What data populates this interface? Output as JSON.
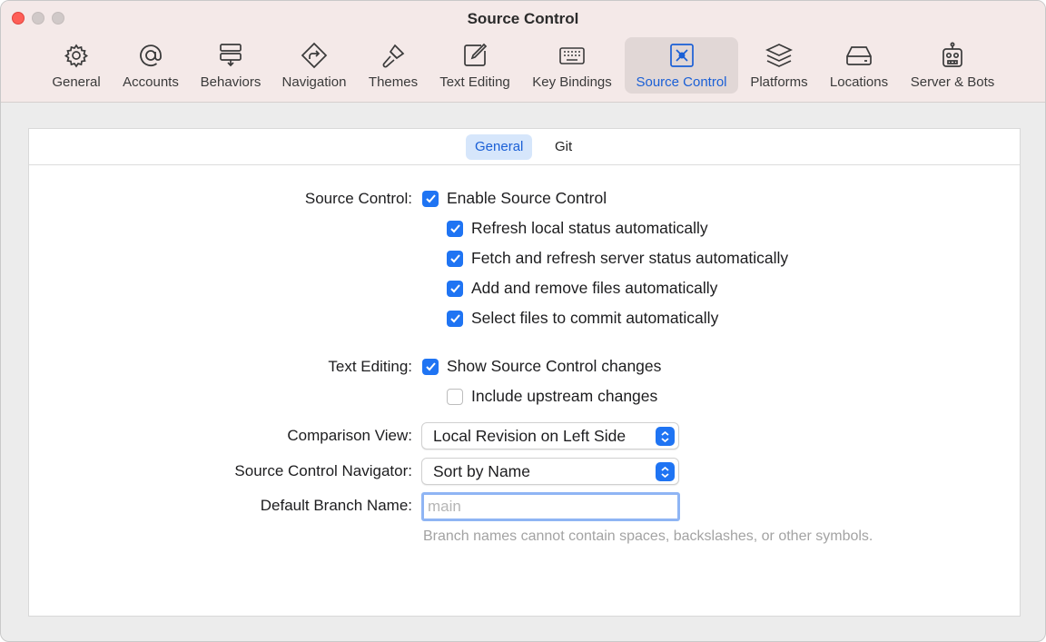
{
  "window": {
    "title": "Source Control"
  },
  "toolbar": {
    "items": [
      {
        "label": "General",
        "icon": "gear-icon"
      },
      {
        "label": "Accounts",
        "icon": "at-icon"
      },
      {
        "label": "Behaviors",
        "icon": "behaviors-icon"
      },
      {
        "label": "Navigation",
        "icon": "navigation-icon"
      },
      {
        "label": "Themes",
        "icon": "paintbrush-icon"
      },
      {
        "label": "Text Editing",
        "icon": "edit-icon"
      },
      {
        "label": "Key Bindings",
        "icon": "keyboard-icon"
      },
      {
        "label": "Source Control",
        "icon": "source-control-icon",
        "selected": true
      },
      {
        "label": "Platforms",
        "icon": "layers-icon"
      },
      {
        "label": "Locations",
        "icon": "drive-icon"
      },
      {
        "label": "Server & Bots",
        "icon": "robot-icon"
      }
    ]
  },
  "tabs": [
    {
      "label": "General",
      "active": true
    },
    {
      "label": "Git",
      "active": false
    }
  ],
  "settings": {
    "source_control_label": "Source Control:",
    "enable_source_control": {
      "label": "Enable Source Control",
      "checked": true
    },
    "refresh_local": {
      "label": "Refresh local status automatically",
      "checked": true
    },
    "fetch_refresh": {
      "label": "Fetch and refresh server status automatically",
      "checked": true
    },
    "add_remove": {
      "label": "Add and remove files automatically",
      "checked": true
    },
    "select_files": {
      "label": "Select files to commit automatically",
      "checked": true
    },
    "text_editing_label": "Text Editing:",
    "show_changes": {
      "label": "Show Source Control changes",
      "checked": true
    },
    "include_upstream": {
      "label": "Include upstream changes",
      "checked": false
    },
    "comparison_view_label": "Comparison View:",
    "comparison_view_value": "Local Revision on Left Side",
    "navigator_label": "Source Control Navigator:",
    "navigator_value": "Sort by Name",
    "branch_label": "Default Branch Name:",
    "branch_placeholder": "main",
    "branch_value": "",
    "branch_hint": "Branch names cannot contain spaces, backslashes, or other symbols."
  },
  "colors": {
    "accent": "#1f74f3",
    "selected_text": "#1a5fd6",
    "close": "#fe5f57"
  }
}
